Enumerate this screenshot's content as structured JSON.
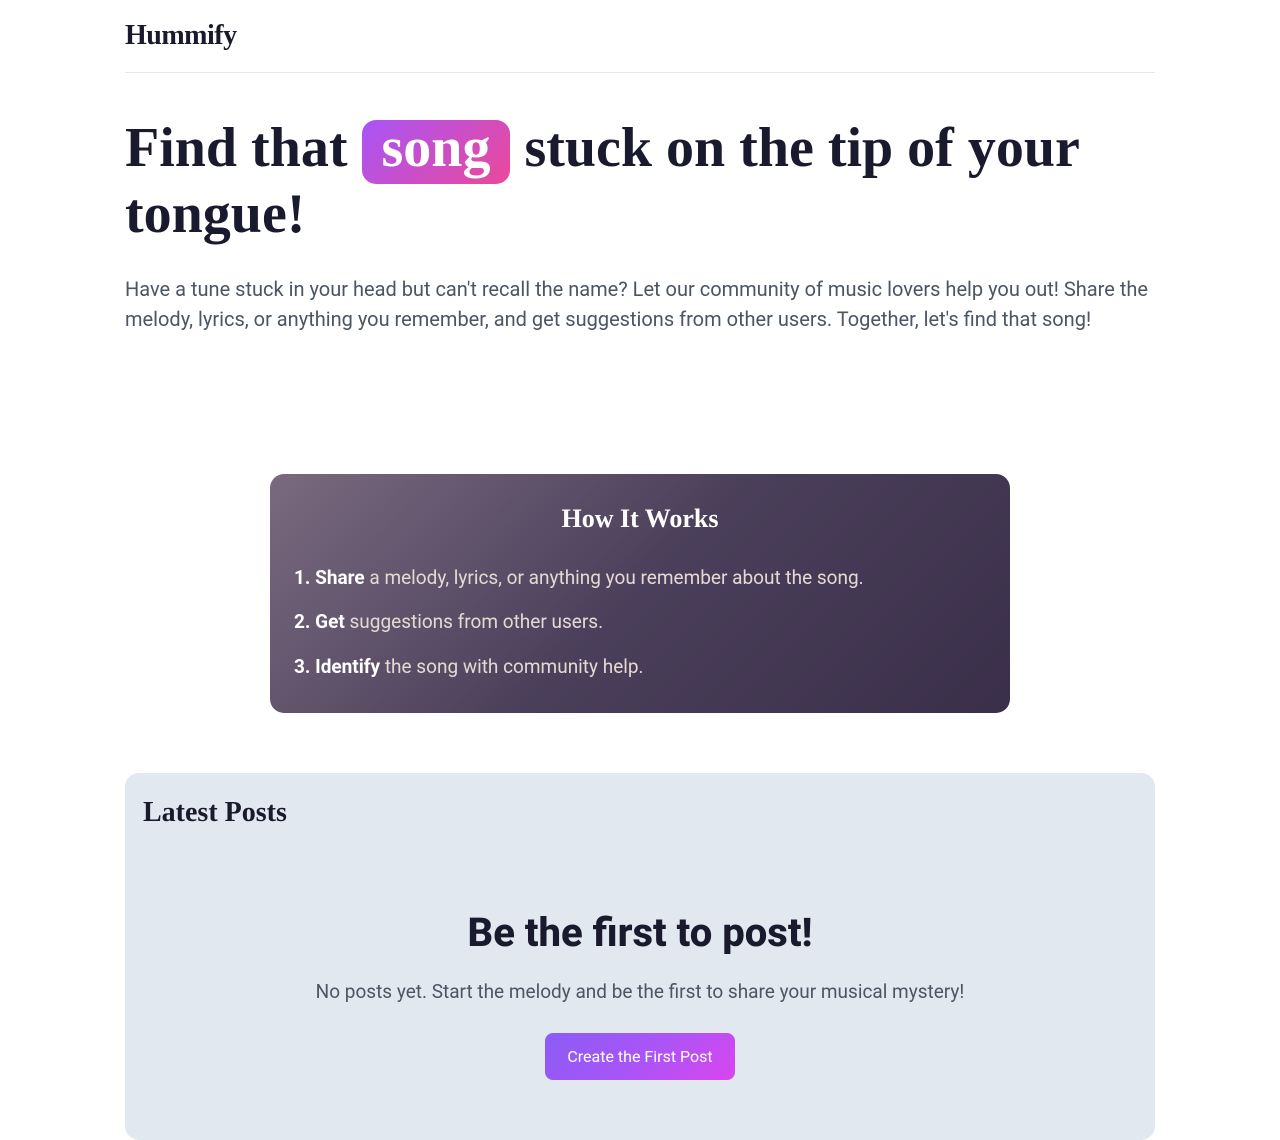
{
  "header": {
    "brand": "Hummify"
  },
  "hero": {
    "title_before": "Find that ",
    "title_highlight": "song",
    "title_after": " stuck on the tip of your tongue!",
    "description": "Have a tune stuck in your head but can't recall the name? Let our community of music lovers help you out! Share the melody, lyrics, or anything you remember, and get suggestions from other users. Together, let's find that song!"
  },
  "howItWorks": {
    "title": "How It Works",
    "steps": [
      {
        "bold": "1. Share",
        "rest": " a melody, lyrics, or anything you remember about the song."
      },
      {
        "bold": "2. Get",
        "rest": " suggestions from other users."
      },
      {
        "bold": "3. Identify",
        "rest": " the song with community help."
      }
    ]
  },
  "latestPosts": {
    "title": "Latest Posts",
    "empty": {
      "title": "Be the first to post!",
      "description": "No posts yet. Start the melody and be the first to share your musical mystery!",
      "button": "Create the First Post"
    }
  }
}
